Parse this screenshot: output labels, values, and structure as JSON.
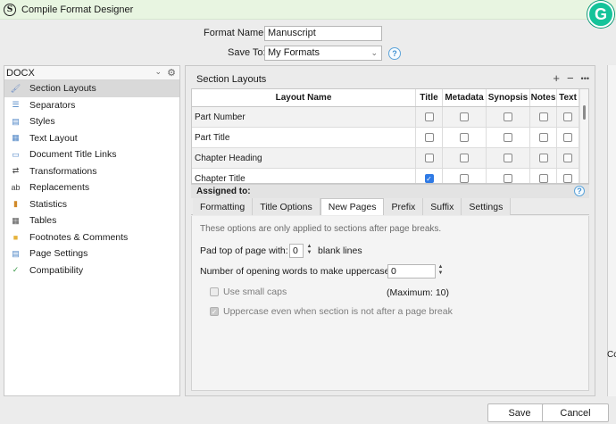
{
  "window": {
    "title": "Compile Format Designer",
    "app_icon": "S",
    "extension_badge": "G"
  },
  "format": {
    "name_label": "Format Name:",
    "name_value": "Manuscript",
    "save_to_label": "Save To:",
    "save_to_value": "My Formats",
    "help": "?"
  },
  "sidebar": {
    "format_select": "DOCX",
    "items": [
      {
        "label": "Section Layouts",
        "icon": "brush-icon",
        "active": true
      },
      {
        "label": "Separators",
        "icon": "separators-icon"
      },
      {
        "label": "Styles",
        "icon": "styles-icon"
      },
      {
        "label": "Text Layout",
        "icon": "text-layout-icon"
      },
      {
        "label": "Document Title Links",
        "icon": "title-links-icon"
      },
      {
        "label": "Transformations",
        "icon": "transformations-icon"
      },
      {
        "label": "Replacements",
        "icon": "replacements-icon"
      },
      {
        "label": "Statistics",
        "icon": "statistics-icon"
      },
      {
        "label": "Tables",
        "icon": "tables-icon"
      },
      {
        "label": "Footnotes & Comments",
        "icon": "footnotes-icon"
      },
      {
        "label": "Page Settings",
        "icon": "page-settings-icon"
      },
      {
        "label": "Compatibility",
        "icon": "compatibility-icon"
      }
    ]
  },
  "section_layouts": {
    "title": "Section Layouts",
    "add": "+",
    "remove": "−",
    "more": "•••",
    "columns": [
      "Layout Name",
      "Title",
      "Metadata",
      "Synopsis",
      "Notes",
      "Text"
    ],
    "rows": [
      {
        "name": "Part Number",
        "checks": [
          false,
          false,
          false,
          false,
          false
        ]
      },
      {
        "name": "Part Title",
        "checks": [
          false,
          false,
          false,
          false,
          false
        ]
      },
      {
        "name": "Chapter Heading",
        "checks": [
          false,
          false,
          false,
          false,
          false
        ]
      },
      {
        "name": "Chapter Title",
        "checks": [
          true,
          false,
          false,
          false,
          false
        ]
      }
    ]
  },
  "assigned": {
    "label": "Assigned to:",
    "help": "?"
  },
  "tabs": [
    "Formatting",
    "Title Options",
    "New Pages",
    "Prefix",
    "Suffix",
    "Settings"
  ],
  "active_tab": "New Pages",
  "new_pages": {
    "note": "These options are only applied to sections after page breaks.",
    "pad_label": "Pad top of page with:",
    "pad_value": "0",
    "pad_suffix": "blank lines",
    "uppercase_label": "Number of opening words to make uppercase:",
    "uppercase_value": "0",
    "small_caps_label": "Use small caps",
    "maximum_label": "(Maximum: 10)",
    "uppercase_always_label": "Uppercase even when section is not after a page break",
    "small_caps_checked": false,
    "uppercase_always_checked": true
  },
  "footer": {
    "save": "Save",
    "cancel": "Cancel"
  },
  "edge_text": "Cc"
}
